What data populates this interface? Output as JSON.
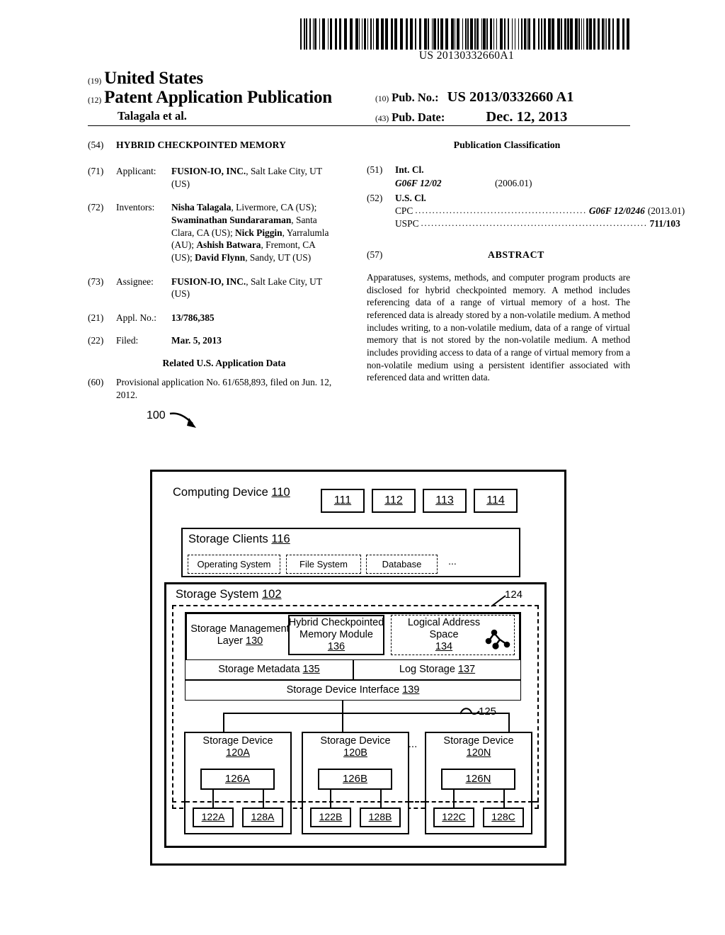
{
  "barcode": {
    "number": "US 20130332660A1"
  },
  "masthead": {
    "code_19": "(19)",
    "country": "United States",
    "code_12": "(12)",
    "doc_type": "Patent Application Publication",
    "authors": "Talagala et al.",
    "code_10": "(10)",
    "pubno_label": "Pub. No.:",
    "pubno_value": "US 2013/0332660 A1",
    "code_43": "(43)",
    "pubdate_label": "Pub. Date:",
    "pubdate_value": "Dec. 12, 2013"
  },
  "left_column": {
    "title": {
      "code": "(54)",
      "text": "HYBRID CHECKPOINTED MEMORY"
    },
    "applicant": {
      "code": "(71)",
      "label": "Applicant:",
      "name": "FUSION-IO, INC.",
      "rest": ", Salt Lake City, UT",
      "line2": "(US)"
    },
    "inventors": {
      "code": "(72)",
      "label": "Inventors:",
      "entries": [
        {
          "name": "Nisha Talagala",
          "rest": ", Livermore, CA (US);"
        },
        {
          "name": "Swaminathan Sundararaman",
          "rest": ", Santa"
        },
        {
          "pre": "Clara, CA (US); ",
          "name": "Nick Piggin",
          "rest": ", Yarralumla"
        },
        {
          "pre": "(AU); ",
          "name": "Ashish Batwara",
          "rest": ", Fremont, CA"
        },
        {
          "pre": "(US); ",
          "name": "David Flynn",
          "rest": ", Sandy, UT (US)"
        }
      ]
    },
    "assignee": {
      "code": "(73)",
      "label": "Assignee:",
      "name": "FUSION-IO, INC.",
      "rest": ", Salt Lake City, UT",
      "line2": "(US)"
    },
    "appl_no": {
      "code": "(21)",
      "label": "Appl. No.:",
      "value": "13/786,385"
    },
    "filed": {
      "code": "(22)",
      "label": "Filed:",
      "value": "Mar. 5, 2013"
    },
    "related_head": "Related U.S. Application Data",
    "related": {
      "code": "(60)",
      "text": "Provisional application No. 61/658,893, filed on Jun. 12, 2012."
    }
  },
  "right_column": {
    "pubclass_head": "Publication Classification",
    "int_cl": {
      "code": "(51)",
      "label": "Int. Cl.",
      "class": "G06F 12/02",
      "version": "(2006.01)"
    },
    "us_cl": {
      "code": "(52)",
      "label": "U.S. Cl.",
      "cpc_label": "CPC",
      "cpc_class": "G06F 12/0246",
      "cpc_version": "(2013.01)",
      "uspc_label": "USPC",
      "uspc_value": "711/103"
    },
    "abstract": {
      "code": "(57)",
      "title": "ABSTRACT",
      "text": "Apparatuses, systems, methods, and computer program products are disclosed for hybrid checkpointed memory. A method includes referencing data of a range of virtual memory of a host. The referenced data is already stored by a non-volatile medium. A method includes writing, to a non-volatile medium, data of a range of virtual memory that is not stored by the non-volatile medium. A method includes providing access to data of a range of virtual memory from a non-volatile medium using a persistent identifier associated with referenced data and written data."
    }
  },
  "figure": {
    "fig_ref": "100",
    "computing_device": {
      "label": "Computing Device",
      "ref": "110"
    },
    "top_boxes": [
      "111",
      "112",
      "113",
      "114"
    ],
    "storage_clients": {
      "label": "Storage Clients",
      "ref": "116",
      "items": [
        "Operating System",
        "File System",
        "Database"
      ],
      "ellipsis": "..."
    },
    "storage_system": {
      "label": "Storage System",
      "ref": "102",
      "boundary_ref": "124",
      "bus_ref": "125",
      "management_layer": {
        "line1": "Storage Management",
        "line2": "Layer",
        "ref": "130"
      },
      "hybrid_module": {
        "line1": "Hybrid Checkpointed",
        "line2": "Memory Module",
        "ref": "136"
      },
      "logical_address_space": {
        "line1": "Logical Address",
        "line2": "Space",
        "ref": "134",
        "icon": "tree-graph-icon"
      },
      "metadata": {
        "label": "Storage Metadata",
        "ref": "135"
      },
      "log_storage": {
        "label": "Log Storage",
        "ref": "137"
      },
      "device_interface": {
        "label": "Storage Device Interface",
        "ref": "139"
      },
      "devices": [
        {
          "label": "Storage Device",
          "ref": "120A",
          "inner": "126A",
          "leaf1": "122A",
          "leaf2": "128A"
        },
        {
          "label": "Storage Device",
          "ref": "120B",
          "inner": "126B",
          "leaf1": "122B",
          "leaf2": "128B"
        },
        {
          "label": "Storage Device",
          "ref": "120N",
          "inner": "126N",
          "leaf1": "122C",
          "leaf2": "128C"
        }
      ],
      "devices_ellipsis": "..."
    }
  }
}
